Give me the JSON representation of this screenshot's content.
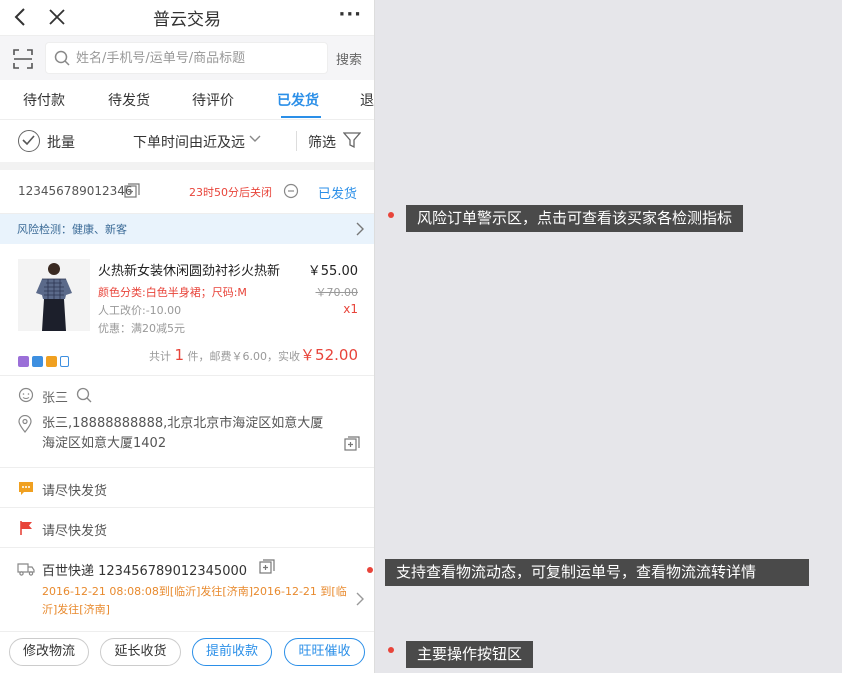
{
  "header": {
    "title": "普云交易"
  },
  "search": {
    "placeholder": "姓名/手机号/运单号/商品标题",
    "button": "搜索"
  },
  "tabs": [
    {
      "label": "待付款"
    },
    {
      "label": "待发货"
    },
    {
      "label": "待评价"
    },
    {
      "label": "已发货"
    },
    {
      "label": "退"
    }
  ],
  "filter": {
    "batch": "批量",
    "sort": "下单时间由近及远",
    "filter": "筛选"
  },
  "order": {
    "id": "123456789012346",
    "countdown": "23时50分后关闭",
    "status": "已发货",
    "risk": "风险检测：健康、新客"
  },
  "product": {
    "name": "火热新女装休闲圆劲衬衫火热新",
    "attr": "颜色分类:白色半身裙；尺码:M",
    "adjust": "人工改价:-10.00",
    "promo": "优惠：满20减5元",
    "price": "￥55.00",
    "orig_price": "￥70.00",
    "qty": "x1"
  },
  "totals": {
    "prefix": "共计",
    "count": "1",
    "suffix": "件，邮费￥6.00，实收",
    "amount": "￥52.00"
  },
  "buyer": {
    "name": "张三",
    "address": "张三,18888888888,北京北京市海淀区如意大厦海淀区如意大厦1402"
  },
  "notes": [
    "请尽快发货",
    "请尽快发货"
  ],
  "logistics": {
    "title": "百世快递 123456789012345000",
    "trace": "2016-12-21 08:08:08到[临沂]发往[济南]2016-12-21 到[临沂]发往[济南]"
  },
  "actions": [
    {
      "label": "修改物流",
      "style": "default"
    },
    {
      "label": "延长收货",
      "style": "default"
    },
    {
      "label": "提前收款",
      "style": "blue"
    },
    {
      "label": "旺旺催收",
      "style": "blue"
    }
  ],
  "annotations": [
    {
      "text": "风险订单警示区，点击可查看该买家各检测指标"
    },
    {
      "text": "支持查看物流动态，可复制运单号，查看物流流转详情"
    },
    {
      "text": "主要操作按钮区"
    }
  ],
  "colors": {
    "accent": "#2b8fe8",
    "alert": "#e8443a",
    "logistics": "#e88a2e"
  }
}
